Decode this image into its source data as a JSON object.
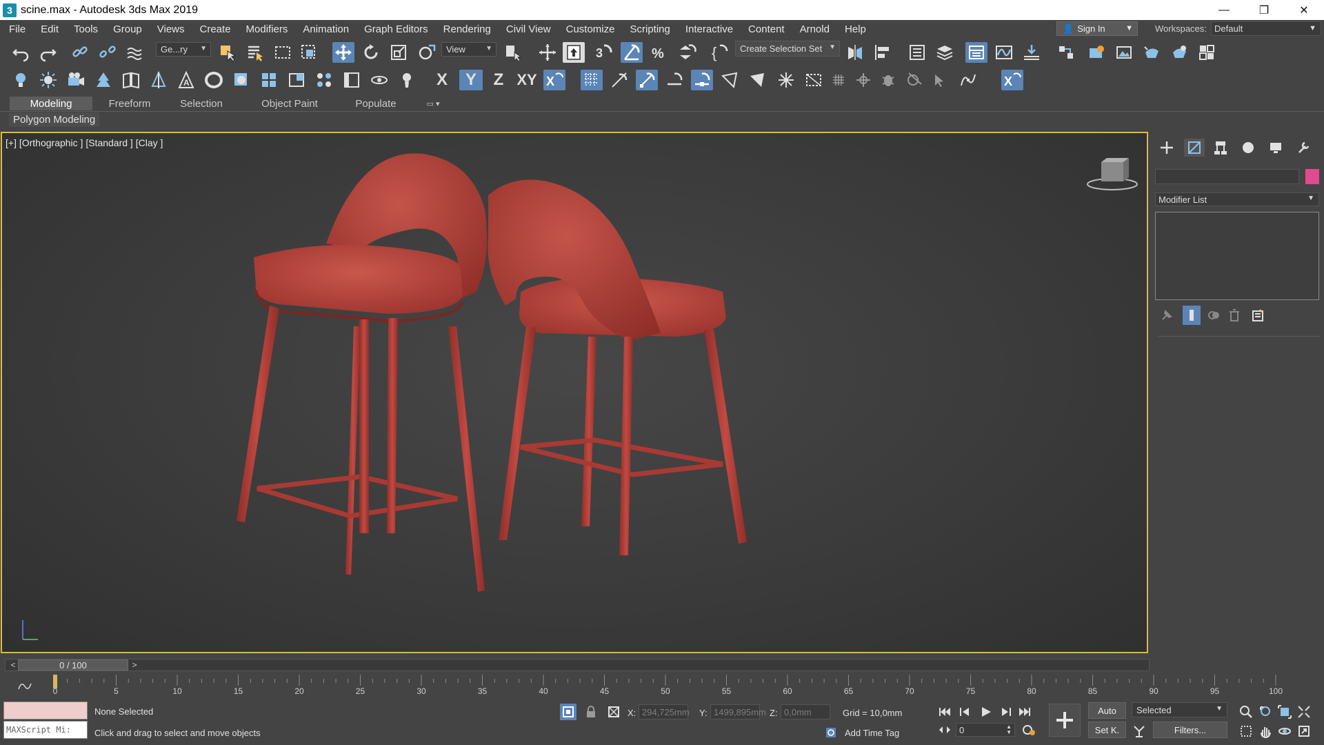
{
  "window": {
    "title": "scine.max - Autodesk 3ds Max 2019",
    "app_icon": "3",
    "minimize": "—",
    "maximize": "❐",
    "close": "✕"
  },
  "menu": [
    "File",
    "Edit",
    "Tools",
    "Group",
    "Views",
    "Create",
    "Modifiers",
    "Animation",
    "Graph Editors",
    "Rendering",
    "Civil View",
    "Customize",
    "Scripting",
    "Interactive",
    "Content",
    "Arnold",
    "Help"
  ],
  "account": {
    "signin": "Sign In",
    "workspaces_label": "Workspaces:",
    "workspace": "Default"
  },
  "toolbar1": {
    "selection_filter": "Ge...ry",
    "ref_coord": "View",
    "selection_set": "Create Selection Set"
  },
  "toolbar2": {
    "axis_x": "X",
    "axis_y": "Y",
    "axis_z": "Z",
    "axis_xy": "XY"
  },
  "ribbon": {
    "tabs": [
      "Modeling",
      "Freeform",
      "Selection",
      "Object Paint",
      "Populate"
    ],
    "active": "Modeling",
    "subpanel": "Polygon Modeling"
  },
  "viewport": {
    "label": "[+] [Orthographic ] [Standard ] [Clay ]"
  },
  "command_panel": {
    "modifier_list": "Modifier List",
    "object_color": "#e04a91"
  },
  "time": {
    "position": "0 / 100",
    "prev": "<",
    "next": ">",
    "ticks": [
      "0",
      "5",
      "10",
      "15",
      "20",
      "25",
      "30",
      "35",
      "40",
      "45",
      "50",
      "55",
      "60",
      "65",
      "70",
      "75",
      "80",
      "85",
      "90",
      "95",
      "100"
    ]
  },
  "status": {
    "maxscript": "MAXScript Mi:",
    "selection": "None Selected",
    "prompt": "Click and drag to select and move objects",
    "x_label": "X:",
    "x_value": "294,725mm",
    "y_label": "Y:",
    "y_value": "1499,895mm",
    "z_label": "Z:",
    "z_value": "0,0mm",
    "grid": "Grid = 10,0mm",
    "add_time_tag": "Add Time Tag",
    "frame": "0",
    "auto": "Auto",
    "setk": "Set K.",
    "key_filter": "Selected",
    "filters": "Filters..."
  },
  "colors": {
    "accent_blue": "#5b85b6",
    "viewport_border": "#d9b75a",
    "chair": "#b4403a"
  }
}
